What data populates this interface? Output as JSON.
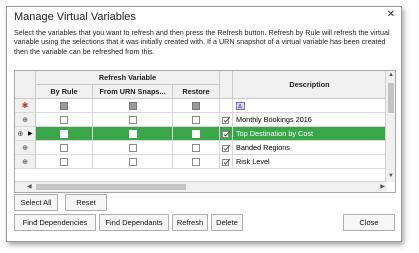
{
  "dialog": {
    "title": "Manage Virtual Variables",
    "description": "Select the variables that you want to refresh and then press the Refresh button.  Refresh by Rule will refresh the virtual variable using the selections that it was initially created with.  If a URN snapshot of a virtual variable has been created then the variable can be refreshed from this."
  },
  "grid": {
    "group_header": "Refresh Variable",
    "columns": {
      "by_rule": "By Rule",
      "from_urn": "From  URN  Snaps...",
      "restore": "Restore",
      "description": "Description"
    },
    "rows": [
      {
        "description": "Monthly Bookings 2016",
        "selected": false
      },
      {
        "description": "Top Destination by Cost",
        "selected": true
      },
      {
        "description": "Banded Regions",
        "selected": false
      },
      {
        "description": "Risk Level",
        "selected": false
      }
    ]
  },
  "buttons": {
    "select_all": "Select All",
    "reset": "Reset",
    "find_dependencies": "Find Dependencies",
    "find_dependants": "Find Dependants",
    "refresh": "Refresh",
    "delete": "Delete",
    "close": "Close"
  },
  "colors": {
    "selected_row": "#3aa64a"
  }
}
